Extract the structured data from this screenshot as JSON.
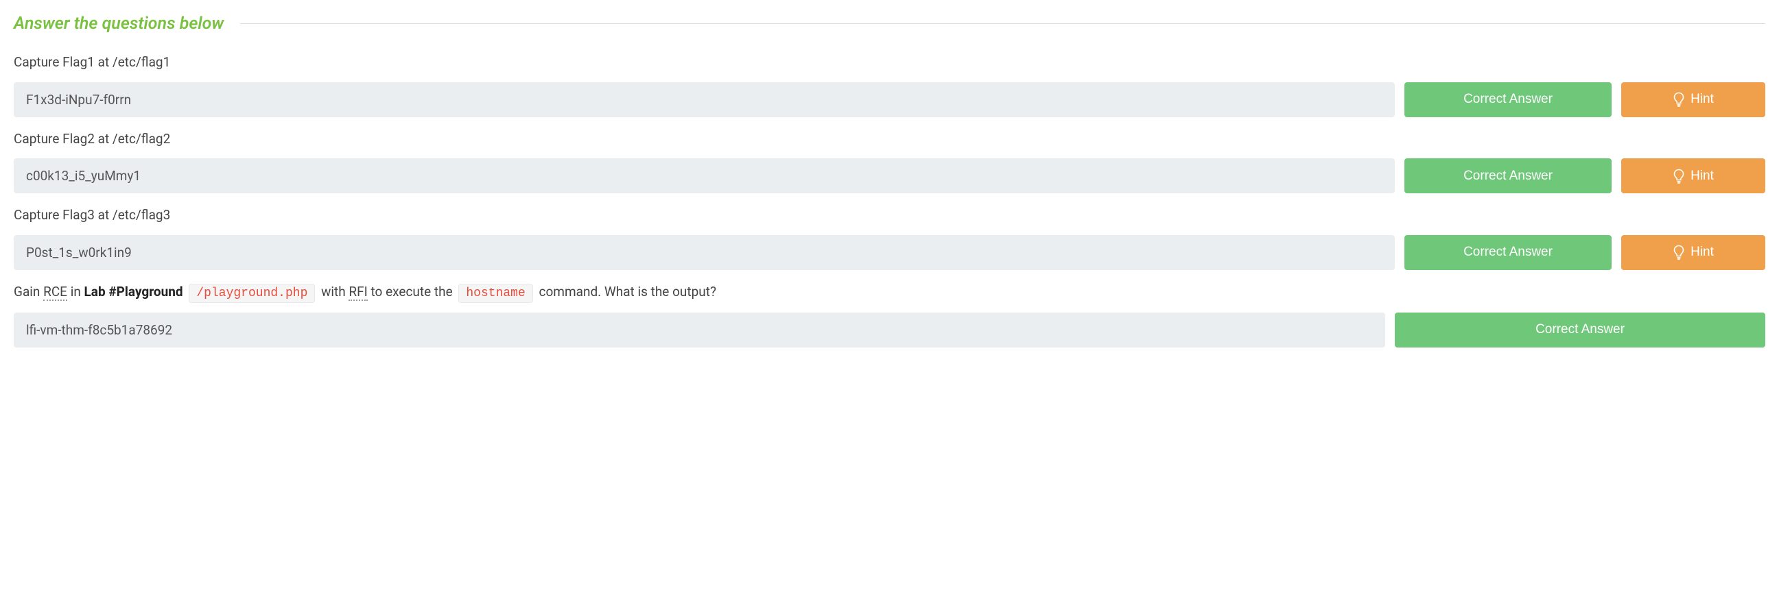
{
  "header": {
    "title": "Answer the questions below"
  },
  "questions": [
    {
      "label": "Capture Flag1 at /etc/flag1",
      "answer": "F1x3d-iNpu7-f0rrn",
      "correct_label": "Correct Answer",
      "hint_label": "Hint",
      "has_hint": true,
      "wide": false
    },
    {
      "label": "Capture Flag2 at /etc/flag2",
      "answer": "c00k13_i5_yuMmy1",
      "correct_label": "Correct Answer",
      "hint_label": "Hint",
      "has_hint": true,
      "wide": false
    },
    {
      "label": "Capture Flag3 at /etc/flag3",
      "answer": "P0st_1s_w0rk1in9",
      "correct_label": "Correct Answer",
      "hint_label": "Hint",
      "has_hint": true,
      "wide": false
    },
    {
      "label_prefix": "Gain ",
      "abbr1": "RCE",
      "label_mid1": " in ",
      "strong": "Lab #Playground",
      "label_mid2": " ",
      "code1": "/playground.php",
      "label_mid3": " with ",
      "abbr2": "RFI",
      "label_mid4": " to execute the ",
      "code2": "hostname",
      "label_suffix": " command. What is the output?",
      "answer": "lfi-vm-thm-f8c5b1a78692",
      "correct_label": "Correct Answer",
      "has_hint": false,
      "wide": true
    }
  ]
}
